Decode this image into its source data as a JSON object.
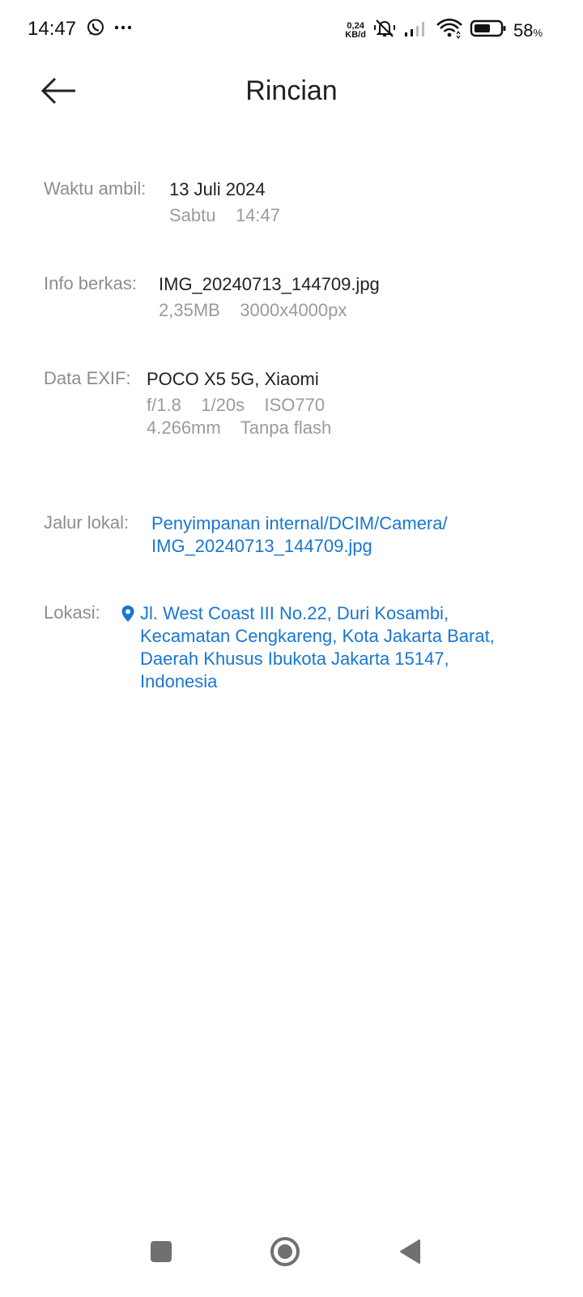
{
  "status_bar": {
    "time": "14:47",
    "speed_value": "0,24",
    "speed_unit": "KB/d",
    "battery_percent": "58",
    "battery_unit": "%",
    "icons": [
      "whatsapp-icon",
      "more-dots-icon",
      "vibrate-mute-icon",
      "signal-icon",
      "wifi-icon",
      "battery-icon"
    ]
  },
  "header": {
    "title": "Rincian",
    "back_icon": "arrow-left-icon"
  },
  "details": {
    "taken": {
      "label": "Waktu ambil:",
      "date": "13 Juli 2024",
      "day_time": "Sabtu    14:47"
    },
    "file_info": {
      "label": "Info berkas:",
      "filename": "IMG_20240713_144709.jpg",
      "size_resolution": "2,35MB    3000x4000px"
    },
    "exif": {
      "label": "Data EXIF:",
      "device": "POCO X5 5G, Xiaomi",
      "exposure": "f/1.8    1/20s    ISO770",
      "lens": "4.266mm    Tanpa flash"
    },
    "local_path": {
      "label": "Jalur lokal:",
      "line1": "Penyimpanan internal/DCIM/Camera/",
      "line2": "IMG_20240713_144709.jpg"
    },
    "location": {
      "label": "Lokasi:",
      "line1": "Jl. West Coast III No.22, Duri Kosambi,",
      "line2": "Kecamatan Cengkareng, Kota Jakarta Barat,",
      "line3": "Daerah Khusus Ibukota Jakarta 15147,",
      "line4": "Indonesia",
      "icon": "location-pin-icon"
    }
  },
  "nav_bar": {
    "items": [
      "recents-square-icon",
      "home-circle-icon",
      "back-triangle-icon"
    ]
  },
  "colors": {
    "link": "#1976d2",
    "label_gray": "#8d8d8d",
    "secondary_gray": "#9b9b9b",
    "text_dark": "#222222",
    "nav_icon": "#707070"
  }
}
